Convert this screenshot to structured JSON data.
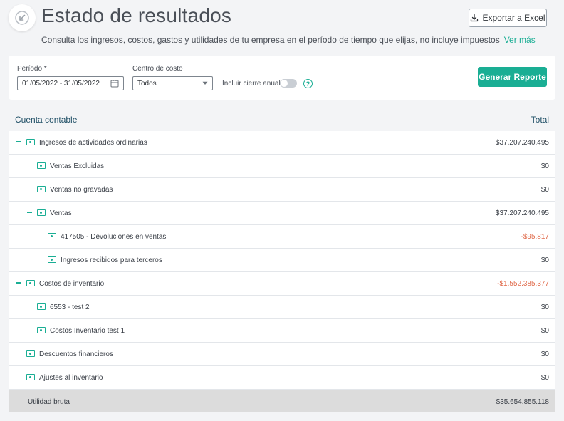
{
  "header": {
    "title": "Estado de resultados",
    "subtitle": "Consulta los ingresos, costos, gastos y utilidades de tu empresa en el período de tiempo que elijas, no incluye impuestos",
    "more_link": "Ver más",
    "export_label": "Exportar a Excel"
  },
  "filters": {
    "period_label": "Período *",
    "period_value": "01/05/2022 - 31/05/2022",
    "cost_center_label": "Centro de costo",
    "cost_center_value": "Todos",
    "include_close_label": "Incluir cierre anual",
    "include_close_on": false,
    "help_symbol": "?",
    "generate_label": "Generar Reporte"
  },
  "table": {
    "col_account": "Cuenta contable",
    "col_total": "Total",
    "rows": [
      {
        "name": "Ingresos de actividades ordinarias",
        "amount": "$37.207.240.495",
        "level": 0,
        "collapsible": true,
        "negative": false
      },
      {
        "name": "Ventas Excluidas",
        "amount": "$0",
        "level": 1,
        "collapsible": false,
        "negative": false
      },
      {
        "name": "Ventas no gravadas",
        "amount": "$0",
        "level": 1,
        "collapsible": false,
        "negative": false
      },
      {
        "name": "Ventas",
        "amount": "$37.207.240.495",
        "level": 1,
        "collapsible": true,
        "negative": false
      },
      {
        "name": "417505 - Devoluciones en ventas",
        "amount": "-$95.817",
        "level": 2,
        "collapsible": false,
        "negative": true
      },
      {
        "name": "Ingresos recibidos para terceros",
        "amount": "$0",
        "level": 2,
        "collapsible": false,
        "negative": false
      },
      {
        "name": "Costos de inventario",
        "amount": "-$1.552.385.377",
        "level": 0,
        "collapsible": true,
        "negative": true
      },
      {
        "name": "6553 - test 2",
        "amount": "$0",
        "level": 1,
        "collapsible": false,
        "negative": false
      },
      {
        "name": "Costos Inventario test 1",
        "amount": "$0",
        "level": 1,
        "collapsible": false,
        "negative": false
      },
      {
        "name": "Descuentos financieros",
        "amount": "$0",
        "level": 0,
        "collapsible": false,
        "negative": false
      },
      {
        "name": "Ajustes al inventario",
        "amount": "$0",
        "level": 0,
        "collapsible": false,
        "negative": false
      }
    ],
    "total": {
      "name": "Utilidad bruta",
      "amount": "$35.654.855.118"
    }
  },
  "colors": {
    "accent": "#1aae94",
    "negative": "#e06a4a",
    "title": "#4a4f57"
  }
}
